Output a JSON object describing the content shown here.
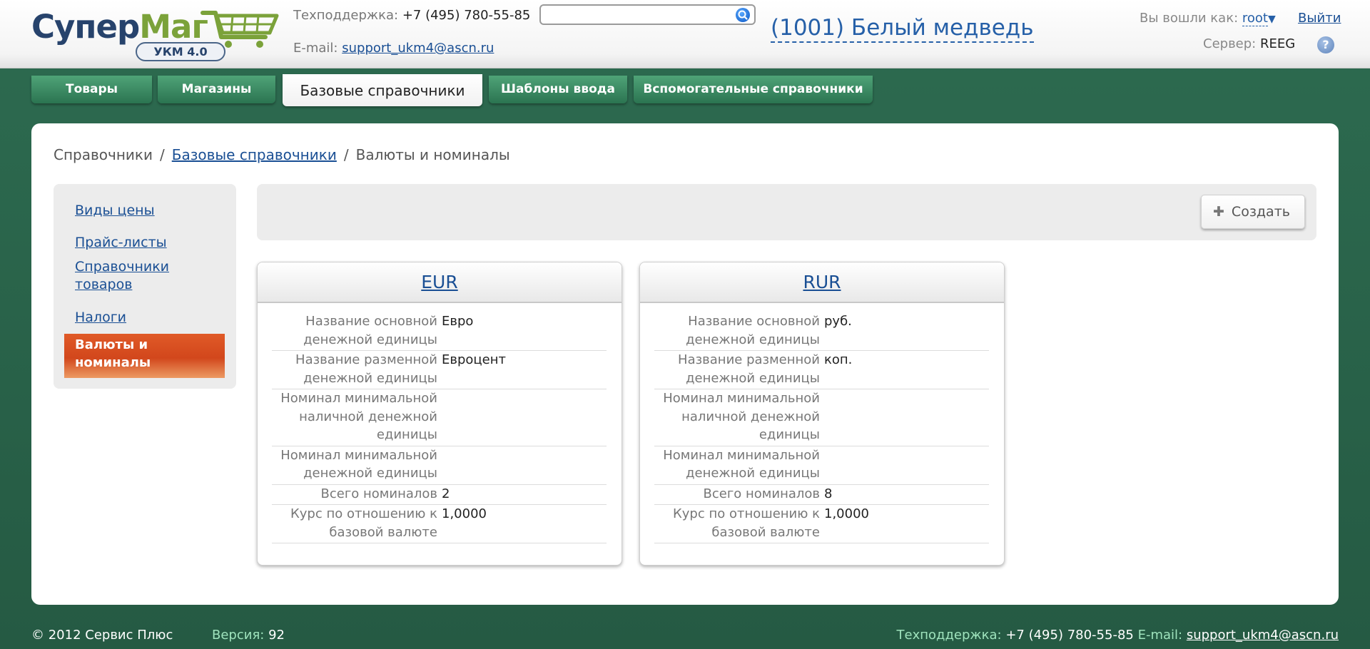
{
  "header": {
    "logo": {
      "text_part1": "Супер",
      "text_part2": "Маг",
      "badge": "УКМ 4.0",
      "cart_icon": "shopping-cart-icon"
    },
    "support": {
      "phone_label": "Техподдержка:",
      "phone": "+7 (495) 780-55-85",
      "email_label": "E-mail:",
      "email": "support_ukm4@ascn.ru"
    },
    "search": {
      "value": "",
      "placeholder": "",
      "icon": "search-icon"
    },
    "store_name": "(1001) Белый медведь",
    "user": {
      "label": "Вы вошли как:",
      "name": "root",
      "caret": "▼"
    },
    "logout_label": "Выйти",
    "server": {
      "label": "Сервер:",
      "name": "REEG"
    },
    "help_label": "?"
  },
  "tabs": [
    {
      "label": "Товары",
      "active": false
    },
    {
      "label": "Магазины",
      "active": false
    },
    {
      "label": "Базовые справочники",
      "active": true
    },
    {
      "label": "Шаблоны ввода",
      "active": false
    },
    {
      "label": "Вспомогательные справочники",
      "active": false
    }
  ],
  "breadcrumb": {
    "root": "Справочники",
    "sep": "/",
    "parent": "Базовые справочники",
    "current": "Валюты и номиналы"
  },
  "sidebar": {
    "items": [
      {
        "label": "Виды цены",
        "active": false
      },
      {
        "label": "Прайс-листы",
        "active": false
      },
      {
        "label": "Справочники товаров",
        "active": false
      },
      {
        "label": "Налоги",
        "active": false
      },
      {
        "label": "Валюты и номиналы",
        "active": true
      }
    ]
  },
  "toolbar": {
    "create_label": "Создать",
    "create_icon": "plus-icon"
  },
  "cards": [
    {
      "title": "EUR",
      "rows": [
        {
          "label": "Название основной денежной единицы",
          "value": "Евро"
        },
        {
          "label": "Название разменной денежной единицы",
          "value": "Евроцент"
        },
        {
          "label": "Номинал минимальной наличной денежной единицы",
          "value": ""
        },
        {
          "label": "Номинал минимальной денежной единицы",
          "value": ""
        },
        {
          "label": "Всего номиналов",
          "value": "2"
        },
        {
          "label": "Курс по отношению к базовой валюте",
          "value": "1,0000"
        }
      ]
    },
    {
      "title": "RUR",
      "rows": [
        {
          "label": "Название основной денежной единицы",
          "value": "руб."
        },
        {
          "label": "Название разменной денежной единицы",
          "value": "коп."
        },
        {
          "label": "Номинал минимальной наличной денежной единицы",
          "value": ""
        },
        {
          "label": "Номинал минимальной денежной единицы",
          "value": ""
        },
        {
          "label": "Всего номиналов",
          "value": "8"
        },
        {
          "label": "Курс по отношению к базовой валюте",
          "value": "1,0000"
        }
      ]
    }
  ],
  "footer": {
    "copyright": "© 2012 Сервис Плюс",
    "version_label": "Версия:",
    "version": "92",
    "support_label": "Техподдержка:",
    "phone": "+7 (495) 780-55-85",
    "email_label": "E-mail:",
    "email": "support_ukm4@ascn.ru"
  },
  "colors": {
    "background_green": "#2d6b50",
    "tab_green": "#3a8a62",
    "active_sidebar_orange": "#d94e20",
    "link_blue": "#1a4f94"
  }
}
